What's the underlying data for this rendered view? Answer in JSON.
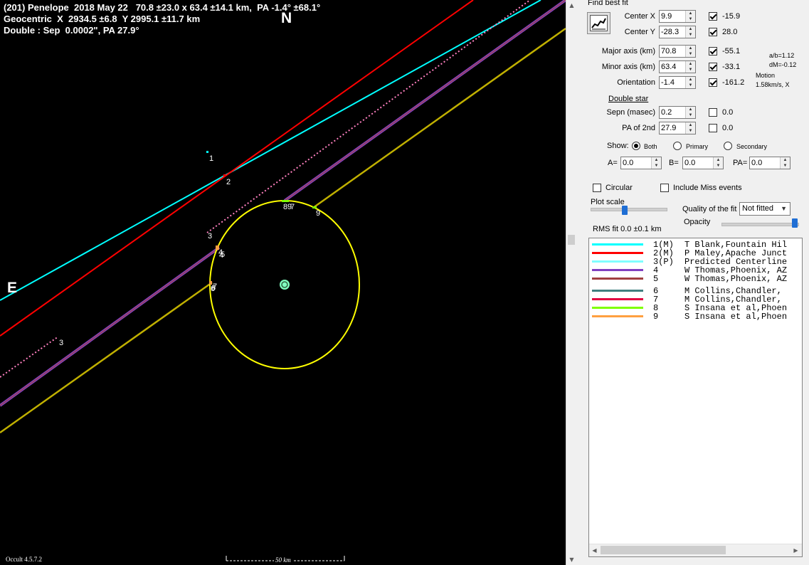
{
  "plot": {
    "header": [
      "(201) Penelope  2018 May 22   70.8 ±23.0 x 63.4 ±14.1 km,  PA -1.4° ±68.1°",
      "Geocentric  X  2934.5 ±6.8  Y 2995.1 ±11.7 km",
      "Double : Sep  0.0002\", PA 27.9°"
    ],
    "north_label": "N",
    "east_label": "E",
    "version": "Occult 4.5.7.2",
    "scale_label": "50 km",
    "chord_labels": [
      "1",
      "2",
      "3",
      "3",
      "4",
      "5",
      "6",
      "7",
      "8",
      "9",
      "9",
      "4",
      "6",
      "7"
    ],
    "colors": {
      "background": "#000000",
      "ellipse": "#ffff00",
      "chord1": "#00ffff",
      "chord2": "#ff0000",
      "predicted": "#ff80c0",
      "chord4": "#8040c0",
      "chord5": "#a04040",
      "chord8": "#80ff00",
      "chord9": "#ffa040",
      "center_marker": "#80ffc0"
    }
  },
  "panel": {
    "find_best_fit": "Find best fit",
    "center_x": {
      "label": "Center X",
      "value": "9.9",
      "checked": true,
      "result": "-15.9"
    },
    "center_y": {
      "label": "Center Y",
      "value": "-28.3",
      "checked": true,
      "result": "28.0"
    },
    "major_axis": {
      "label": "Major axis (km)",
      "value": "70.8",
      "checked": true,
      "result": "-55.1"
    },
    "minor_axis": {
      "label": "Minor axis (km)",
      "value": "63.4",
      "checked": true,
      "result": "-33.1"
    },
    "orientation": {
      "label": "Orientation",
      "value": "-1.4",
      "checked": true,
      "result": "-161.2"
    },
    "ab_ratio": "a/b=1.12",
    "dm": "dM=-0.12",
    "motion_label": "Motion",
    "motion_value": "1.58km/s, X",
    "double_star": "Double star",
    "sepn": {
      "label": "Sepn (masec)",
      "value": "0.2",
      "checked": false,
      "result": "0.0"
    },
    "pa2nd": {
      "label": "PA of 2nd",
      "value": "27.9",
      "checked": false,
      "result": "0.0"
    },
    "show_label": "Show:",
    "show_options": [
      "Both",
      "Primary",
      "Secondary"
    ],
    "show_selected": "Both",
    "a_label": "A=",
    "a_value": "0.0",
    "b_label": "B=",
    "b_value": "0.0",
    "pa_label": "PA=",
    "pa_value": "0.0",
    "circular_label": "Circular",
    "circular_checked": false,
    "miss_label": "Include Miss events",
    "miss_checked": false,
    "plot_scale_label": "Plot scale",
    "plot_scale_level": 0.45,
    "quality_label": "Quality of the fit",
    "quality_value": "Not fitted",
    "opacity_label": "Opacity",
    "opacity_level": 1.0,
    "rms_fit": "RMS fit 0.0 ±0.1 km",
    "legend": [
      {
        "num": "1(M)",
        "text": "T Blank,Fountain Hil",
        "color": "#00ffff"
      },
      {
        "num": "2(M)",
        "text": "P Maley,Apache Junct",
        "color": "#ff0000"
      },
      {
        "num": "3(P)",
        "text": "Predicted Centerline",
        "color": "#80ffff"
      },
      {
        "num": "4",
        "text": "W Thomas,Phoenix, AZ",
        "color": "#8040c0"
      },
      {
        "num": "5",
        "text": "W Thomas,Phoenix, AZ",
        "color": "#a04040"
      },
      {
        "num": "6",
        "text": "M Collins,Chandler,",
        "color": "#408080"
      },
      {
        "num": "7",
        "text": "M Collins,Chandler,",
        "color": "#e00040"
      },
      {
        "num": "8",
        "text": "S Insana et al,Phoen",
        "color": "#80ff00"
      },
      {
        "num": "9",
        "text": "S Insana et al,Phoen",
        "color": "#ffa040"
      }
    ]
  }
}
